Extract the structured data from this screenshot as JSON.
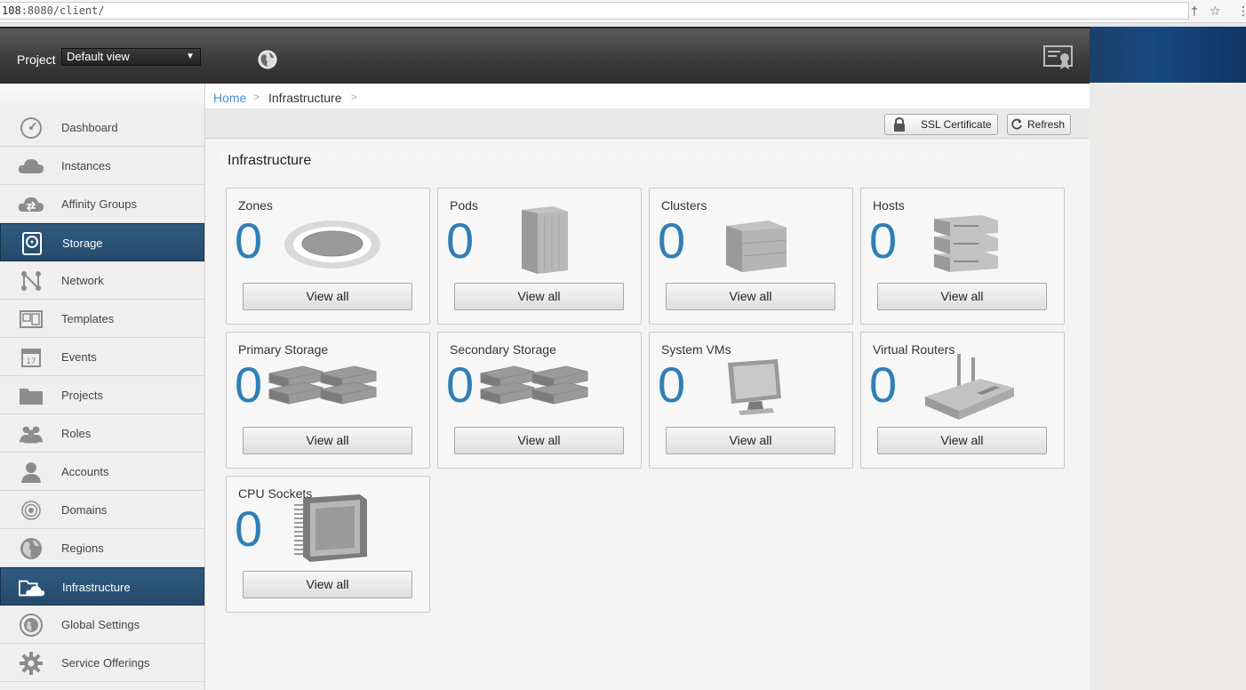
{
  "browser": {
    "url_host": "108",
    "url_rest": ":8080/client/"
  },
  "header": {
    "project_label": "Project",
    "project_value": "Default view"
  },
  "sidebar": {
    "items": [
      {
        "label": "Dashboard",
        "icon": "dashboard-icon",
        "active": false
      },
      {
        "label": "Instances",
        "icon": "cloud-icon",
        "active": false
      },
      {
        "label": "Affinity Groups",
        "icon": "affinity-cloud-icon",
        "active": false
      },
      {
        "label": "Storage",
        "icon": "storage-disk-icon",
        "active": true
      },
      {
        "label": "Network",
        "icon": "network-icon",
        "active": false
      },
      {
        "label": "Templates",
        "icon": "templates-icon",
        "active": false
      },
      {
        "label": "Events",
        "icon": "calendar-icon",
        "active": false
      },
      {
        "label": "Projects",
        "icon": "folder-icon",
        "active": false
      },
      {
        "label": "Roles",
        "icon": "roles-icon",
        "active": false
      },
      {
        "label": "Accounts",
        "icon": "user-icon",
        "active": false
      },
      {
        "label": "Domains",
        "icon": "domains-icon",
        "active": false
      },
      {
        "label": "Regions",
        "icon": "globe-icon",
        "active": false
      },
      {
        "label": "Infrastructure",
        "icon": "infrastructure-icon",
        "active": true
      },
      {
        "label": "Global Settings",
        "icon": "globe-settings-icon",
        "active": false
      },
      {
        "label": "Service Offerings",
        "icon": "gear-icon",
        "active": false
      }
    ]
  },
  "breadcrumb": {
    "home": "Home",
    "separator": ">",
    "current": "Infrastructure"
  },
  "toolbar": {
    "ssl_label": "SSL Certificate",
    "refresh_label": "Refresh"
  },
  "main": {
    "title": "Infrastructure",
    "cards": [
      {
        "title": "Zones",
        "count": "0",
        "button": "View all",
        "icon": "zone-disc-icon"
      },
      {
        "title": "Pods",
        "count": "0",
        "button": "View all",
        "icon": "pod-rack-icon"
      },
      {
        "title": "Clusters",
        "count": "0",
        "button": "View all",
        "icon": "cluster-box-icon"
      },
      {
        "title": "Hosts",
        "count": "0",
        "button": "View all",
        "icon": "host-server-icon"
      },
      {
        "title": "Primary Storage",
        "count": "0",
        "button": "View all",
        "icon": "primary-storage-icon"
      },
      {
        "title": "Secondary Storage",
        "count": "0",
        "button": "View all",
        "icon": "secondary-storage-icon"
      },
      {
        "title": "System VMs",
        "count": "0",
        "button": "View all",
        "icon": "monitor-icon"
      },
      {
        "title": "Virtual Routers",
        "count": "0",
        "button": "View all",
        "icon": "router-icon"
      },
      {
        "title": "CPU Sockets",
        "count": "0",
        "button": "View all",
        "icon": "cpu-chip-icon"
      }
    ]
  },
  "colors": {
    "accent": "#2f7fb6",
    "active_nav": "#2a5476",
    "header": "#3a3a3a",
    "link": "#4a90d0"
  }
}
